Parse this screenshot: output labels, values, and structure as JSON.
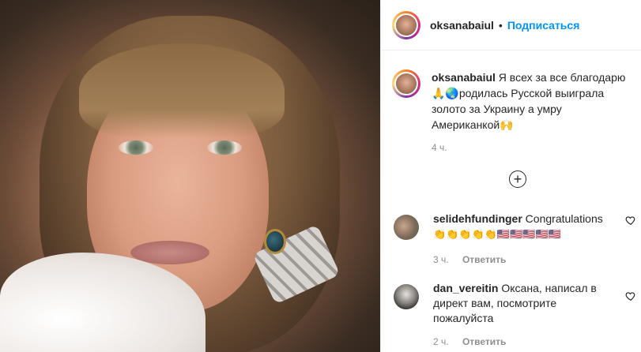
{
  "post": {
    "author": "oksanabaiul",
    "follow_label": "Подписаться",
    "dot": "•",
    "caption_text": " Я всех за все благодарю 🙏🌏родилась Русской выиграла золото за Украину а умру Американкой🙌",
    "caption_time": "4 ч."
  },
  "comments": [
    {
      "user": "selidehfundinger",
      "text": " Congratulations",
      "emojis": "👏👏👏👏👏🇺🇸🇺🇸🇺🇸🇺🇸🇺🇸",
      "time": "3 ч.",
      "reply_label": "Ответить"
    },
    {
      "user": "dan_vereitin",
      "text": " Оксана, написал в директ вам, посмотрите пожалуйста",
      "time": "2 ч.",
      "reply_label": "Ответить"
    }
  ],
  "icons": {
    "add": "plus-circle-icon",
    "like": "heart-icon"
  },
  "colors": {
    "accent": "#0095f6",
    "muted": "#8e8e8e",
    "text": "#262626"
  }
}
